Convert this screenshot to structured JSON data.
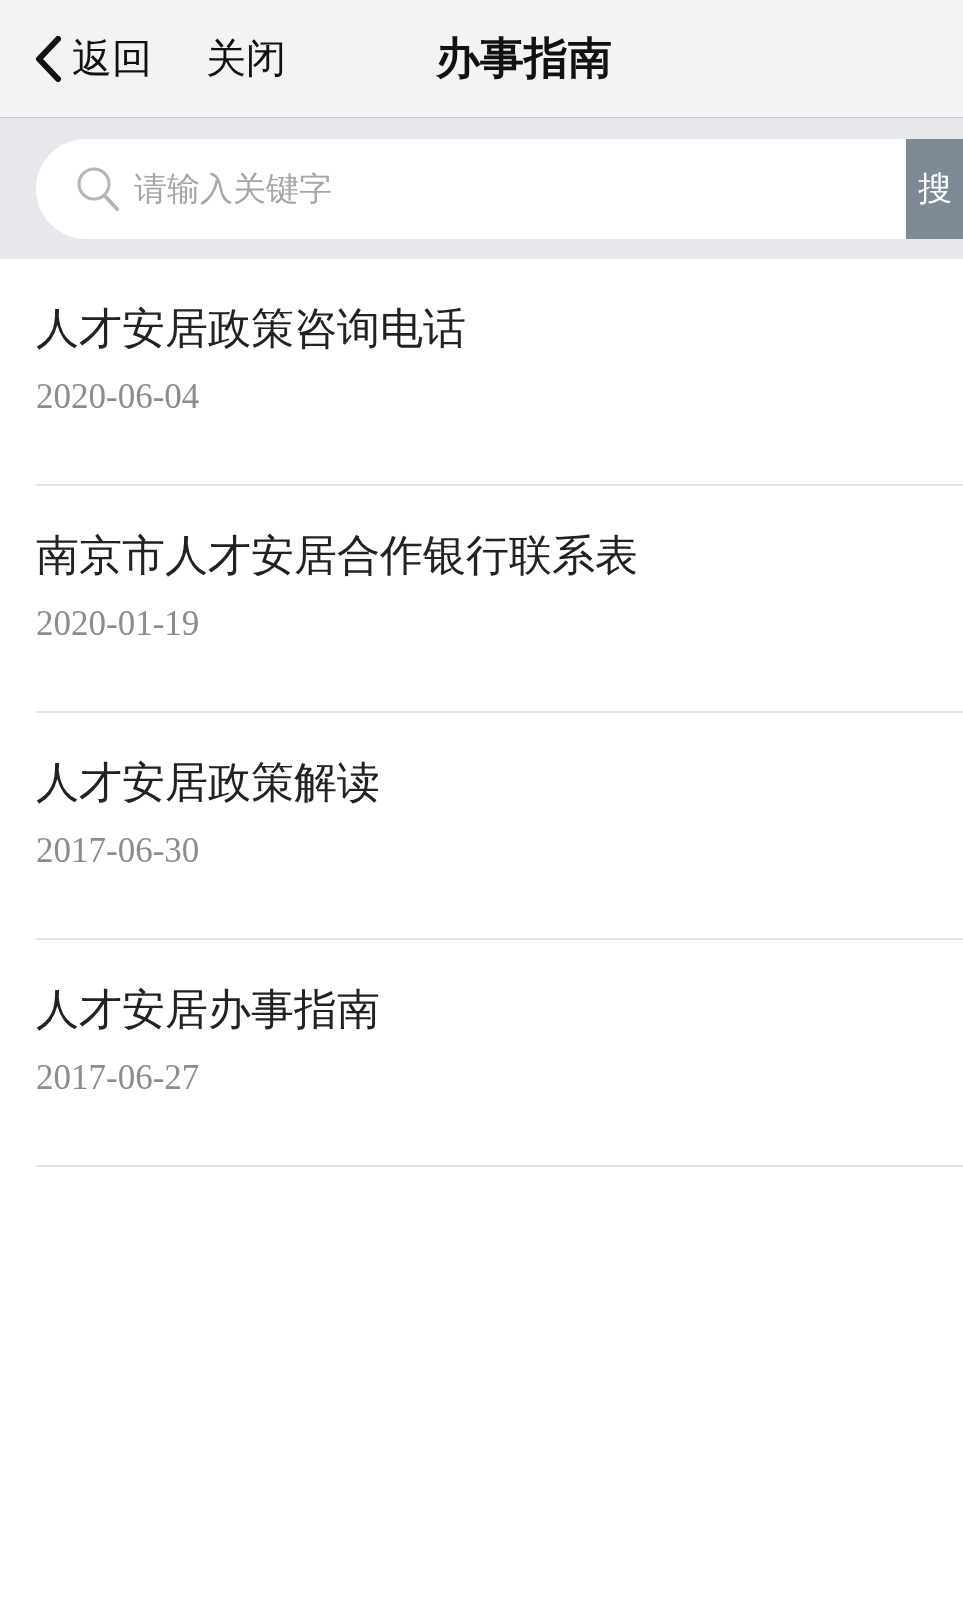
{
  "nav_bar": {
    "back_label": "返回",
    "close_label": "关闭",
    "title": "办事指南"
  },
  "search": {
    "placeholder": "请输入关键字",
    "button_label": "搜"
  },
  "items": [
    {
      "title": "人才安居政策咨询电话",
      "date": "2020-06-04"
    },
    {
      "title": "南京市人才安居合作银行联系表",
      "date": "2020-01-19"
    },
    {
      "title": "人才安居政策解读",
      "date": "2017-06-30"
    },
    {
      "title": "人才安居办事指南",
      "date": "2017-06-27"
    }
  ]
}
